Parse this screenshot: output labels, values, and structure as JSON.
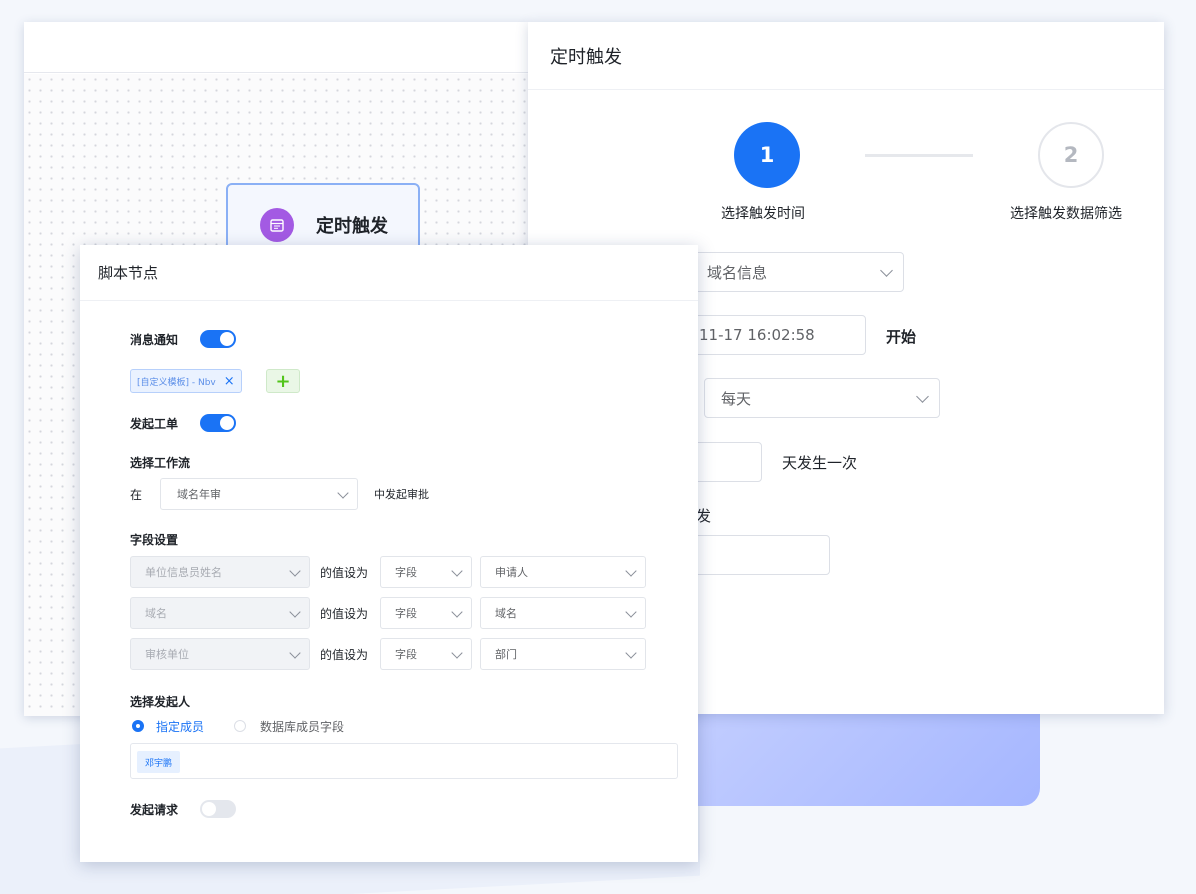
{
  "canvas": {
    "node_label": "定时触发",
    "node_icon": "calendar-icon"
  },
  "timer_dialog": {
    "title": "定时触发",
    "steps": [
      {
        "number": "1",
        "title": "选择触发时间",
        "active": true
      },
      {
        "number": "2",
        "title": "选择触发数据筛选",
        "active": false
      }
    ],
    "data_source_value": "域名信息",
    "start_time_value": "11-17 16:02:58",
    "start_suffix": "开始",
    "frequency_value": "每天",
    "interval_suffix": "天发生一次",
    "partial_label": "发"
  },
  "script_dialog": {
    "title": "脚本节点",
    "notify_label": "消息通知",
    "notify_on": true,
    "notify_tag": "[自定义模板] - Nbv",
    "workorder_label": "发起工单",
    "workorder_on": true,
    "workflow_label": "选择工作流",
    "workflow_prefix": "在",
    "workflow_value": "域名年审",
    "workflow_suffix": "中发起审批",
    "field_label": "字段设置",
    "field_rows": [
      {
        "target": "单位信息员姓名",
        "op": "的值设为",
        "type": "字段",
        "value": "申请人"
      },
      {
        "target": "域名",
        "op": "的值设为",
        "type": "字段",
        "value": "域名"
      },
      {
        "target": "审核单位",
        "op": "的值设为",
        "type": "字段",
        "value": "部门"
      }
    ],
    "initiator_label": "选择发起人",
    "initiator_options": [
      "指定成员",
      "数据库成员字段"
    ],
    "member_tag": "邓宇鹏",
    "request_label": "发起请求",
    "request_on": false
  },
  "colors": {
    "primary": "#1a73f5",
    "node_icon_bg": "#a35ae3",
    "add_green": "#52c41a"
  }
}
